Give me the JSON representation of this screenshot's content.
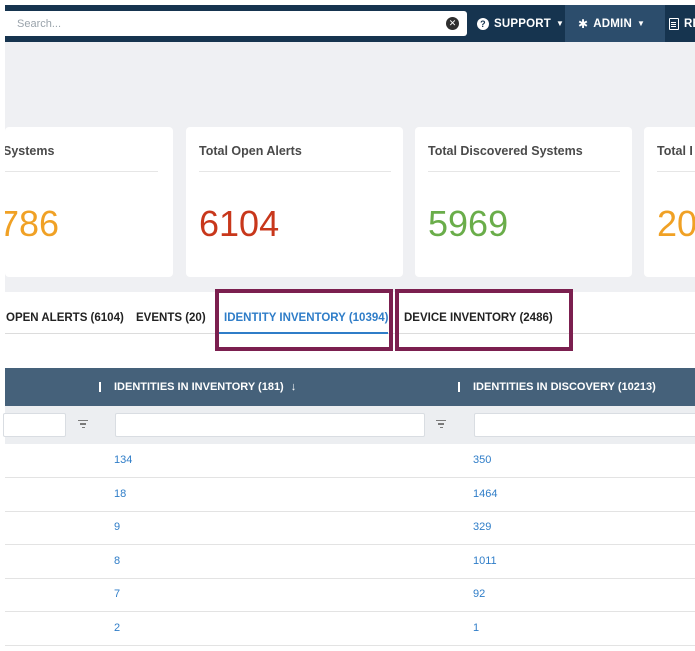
{
  "header": {
    "search_placeholder": "Search...",
    "clear_symbol": "✕",
    "support_label": "SUPPORT",
    "admin_label": "ADMIN",
    "reports_label": "RE"
  },
  "cards": [
    {
      "title": "Systems",
      "value": "786",
      "color": "#f0a125"
    },
    {
      "title": "Total Open Alerts",
      "value": "6104",
      "color": "#c8371b"
    },
    {
      "title": "Total Discovered Systems",
      "value": "5969",
      "color": "#6aad4a"
    },
    {
      "title": "Total I",
      "value": "20",
      "color": "#f0a125"
    }
  ],
  "tabs": [
    {
      "label": "OPEN ALERTS (6104)",
      "active": false
    },
    {
      "label": "EVENTS (20)",
      "active": false
    },
    {
      "label": "IDENTITY INVENTORY (10394)",
      "active": true
    },
    {
      "label": "DEVICE INVENTORY (2486)",
      "active": false
    }
  ],
  "table": {
    "columns": [
      {
        "label": "IDENTITIES IN INVENTORY (181)",
        "sort_icon": "↓"
      },
      {
        "label": "IDENTITIES IN DISCOVERY (10213)"
      }
    ],
    "rows": [
      [
        "134",
        "350"
      ],
      [
        "18",
        "1464"
      ],
      [
        "9",
        "329"
      ],
      [
        "8",
        "1011"
      ],
      [
        "7",
        "92"
      ],
      [
        "2",
        "1"
      ]
    ]
  }
}
